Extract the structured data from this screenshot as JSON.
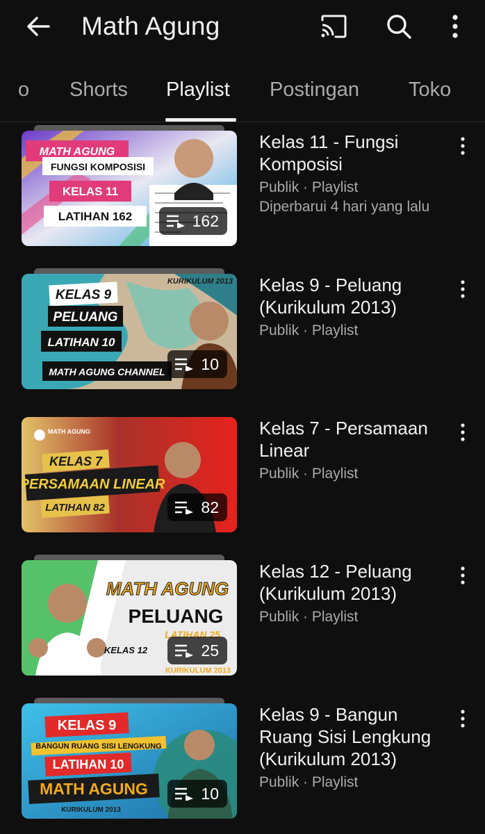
{
  "appbar": {
    "title": "Math Agung",
    "icons": [
      "back-arrow-icon",
      "cast-icon",
      "search-icon",
      "more-vert-icon"
    ]
  },
  "tabs": [
    {
      "label": "o",
      "active": false
    },
    {
      "label": "Shorts",
      "active": false
    },
    {
      "label": "Playlist",
      "active": true
    },
    {
      "label": "Postingan",
      "active": false
    },
    {
      "label": "Toko",
      "active": false
    }
  ],
  "playlists": [
    {
      "title": "Kelas 11 - Fungsi Komposisi",
      "meta": "Publik · Playlist",
      "updated": "Diperbarui 4 hari yang lalu",
      "count": "162",
      "thumb": {
        "line1": "MATH AGUNG",
        "line2": "FUNGSI KOMPOSISI",
        "line3": "KELAS 11",
        "line4": "LATIHAN 162"
      }
    },
    {
      "title": "Kelas 9 - Peluang (Kurikulum 2013)",
      "meta": "Publik · Playlist",
      "count": "10",
      "thumb": {
        "corner": "KURIKULUM 2013",
        "line1": "KELAS 9",
        "line2": "PELUANG",
        "line3": "LATIHAN 10",
        "line4": "MATH AGUNG CHANNEL"
      }
    },
    {
      "title": "Kelas 7 - Persamaan Linear",
      "meta": "Publik · Playlist",
      "count": "82",
      "thumb": {
        "logo": "MATH AGUNG",
        "line1": "KELAS 7",
        "line2": "PERSAMAAN LINEAR",
        "line3": "LATIHAN 82"
      }
    },
    {
      "title": "Kelas 12 - Peluang (Kurikulum 2013)",
      "meta": "Publik · Playlist",
      "count": "25",
      "thumb": {
        "line1": "MATH AGUNG",
        "line2": "PELUANG",
        "line3": "KELAS 12",
        "line4": "LATIHAN 25",
        "line5": "KURIKULUM 2013"
      }
    },
    {
      "title": "Kelas 9 - Bangun Ruang Sisi Lengkung (Kurikulum 2013)",
      "meta": "Publik · Playlist",
      "count": "10",
      "thumb": {
        "line1": "KELAS 9",
        "line2": "BANGUN RUANG SISI LENGKUNG",
        "line3": "LATIHAN 10",
        "line4": "MATH AGUNG",
        "line5": "KURIKULUM 2013"
      }
    }
  ],
  "colors": {
    "background": "#0f0f0f",
    "text": "#f1f1f1",
    "secondary": "#aaaaaa"
  }
}
